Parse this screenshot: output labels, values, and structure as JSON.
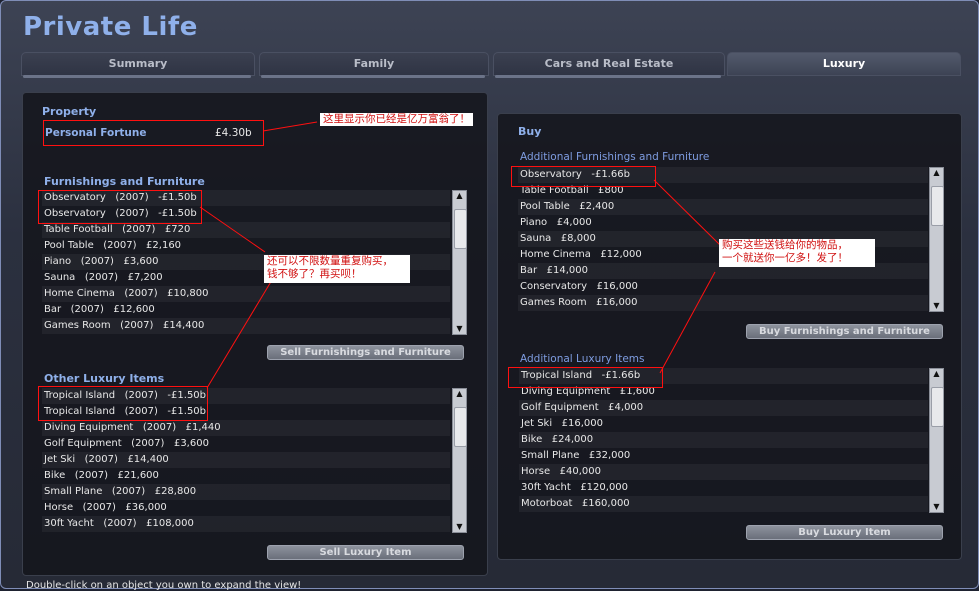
{
  "page_title": "Private Life",
  "tabs": [
    {
      "label": "Summary"
    },
    {
      "label": "Family"
    },
    {
      "label": "Cars and Real Estate"
    },
    {
      "label": "Luxury"
    }
  ],
  "left": {
    "property_heading": "Property",
    "fortune_label": "Personal Fortune",
    "fortune_value": "£4.30b",
    "furnishings_heading": "Furnishings and Furniture",
    "furnishings": [
      "Observatory   (2007)   -£1.50b",
      "Observatory   (2007)   -£1.50b",
      "Table Football   (2007)   £720",
      "Pool Table   (2007)   £2,160",
      "Piano   (2007)   £3,600",
      "Sauna   (2007)   £7,200",
      "Home Cinema   (2007)   £10,800",
      "Bar   (2007)   £12,600",
      "Games Room   (2007)   £14,400"
    ],
    "sell_furnishings_label": "Sell Furnishings and Furniture",
    "luxury_heading": "Other Luxury Items",
    "luxury": [
      "Tropical Island   (2007)   -£1.50b",
      "Tropical Island   (2007)   -£1.50b",
      "Diving Equipment   (2007)   £1,440",
      "Golf Equipment   (2007)   £3,600",
      "Jet Ski   (2007)   £14,400",
      "Bike   (2007)   £21,600",
      "Small Plane   (2007)   £28,800",
      "Horse   (2007)   £36,000",
      "30ft Yacht   (2007)   £108,000"
    ],
    "sell_luxury_label": "Sell Luxury Item"
  },
  "right": {
    "buy_heading": "Buy",
    "furnishings_heading": "Additional Furnishings and Furniture",
    "furnishings": [
      "Observatory   -£1.66b",
      "Table Football   £800",
      "Pool Table   £2,400",
      "Piano   £4,000",
      "Sauna   £8,000",
      "Home Cinema   £12,000",
      "Bar   £14,000",
      "Conservatory   £16,000",
      "Games Room   £16,000"
    ],
    "buy_furnishings_label": "Buy Furnishings and Furniture",
    "luxury_heading": "Additional Luxury Items",
    "luxury": [
      "Tropical Island   -£1.66b",
      "Diving Equipment   £1,600",
      "Golf Equipment   £4,000",
      "Jet Ski   £16,000",
      "Bike   £24,000",
      "Small Plane   £32,000",
      "Horse   £40,000",
      "30ft Yacht   £120,000",
      "Motorboat   £160,000"
    ],
    "buy_luxury_label": "Buy Luxury Item"
  },
  "annotations": {
    "fortune_note": "这里显示你已经是亿万富翁了！",
    "repeat_note_1": "还可以不限数量重复购买，",
    "repeat_note_2": "钱不够了？再买呗！",
    "buy_note_1": "购买这些送钱给你的物品，",
    "buy_note_2": "一个就送你一亿多！发了！"
  },
  "footer_text": "Double-click on an object you own to expand the view!",
  "colors": {
    "accent": "#8fb0ea",
    "annotation": "#ff1010"
  }
}
